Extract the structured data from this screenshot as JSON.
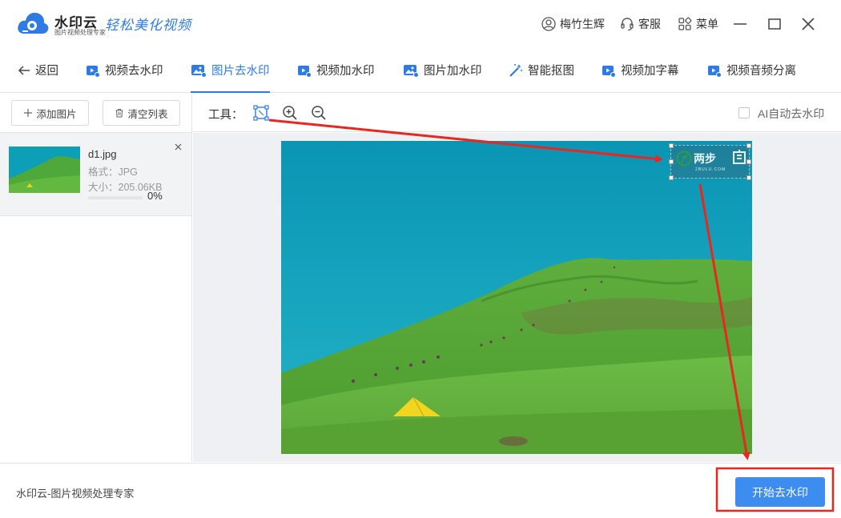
{
  "app": {
    "name": "水印云",
    "subtitle": "图片视频处理专家",
    "slogan": "轻松美化视频",
    "user_name": "梅竹生辉",
    "service_label": "客服",
    "menu_label": "菜单"
  },
  "nav": {
    "back_label": "返回",
    "items": [
      {
        "label": "视频去水印",
        "icon": "video-icon",
        "active": false
      },
      {
        "label": "图片去水印",
        "icon": "image-icon",
        "active": true
      },
      {
        "label": "视频加水印",
        "icon": "video-icon",
        "active": false
      },
      {
        "label": "图片加水印",
        "icon": "image-icon",
        "active": false
      },
      {
        "label": "智能抠图",
        "icon": "magic-wand-icon",
        "active": false
      },
      {
        "label": "视频加字幕",
        "icon": "video-icon",
        "active": false
      },
      {
        "label": "视频音频分离",
        "icon": "video-icon",
        "active": false
      }
    ]
  },
  "sidebar": {
    "add_label": "添加图片",
    "clear_label": "清空列表",
    "file": {
      "name": "d1.jpg",
      "format": "格式：JPG",
      "size": "大小：205.06KB",
      "progress_text": "0%",
      "progress": 0
    }
  },
  "toolbar": {
    "label": "工具：",
    "ai_label": "AI自动去水印",
    "ai_checked": false
  },
  "watermark": {
    "text": "两步",
    "sub": "2BULU.COM"
  },
  "footer": {
    "text": "水印云-图片视频处理专家",
    "start_label": "开始去水印"
  },
  "colors": {
    "accent": "#2f7be6",
    "start_button": "#3d8cf0",
    "annotation": "#e8271f"
  }
}
